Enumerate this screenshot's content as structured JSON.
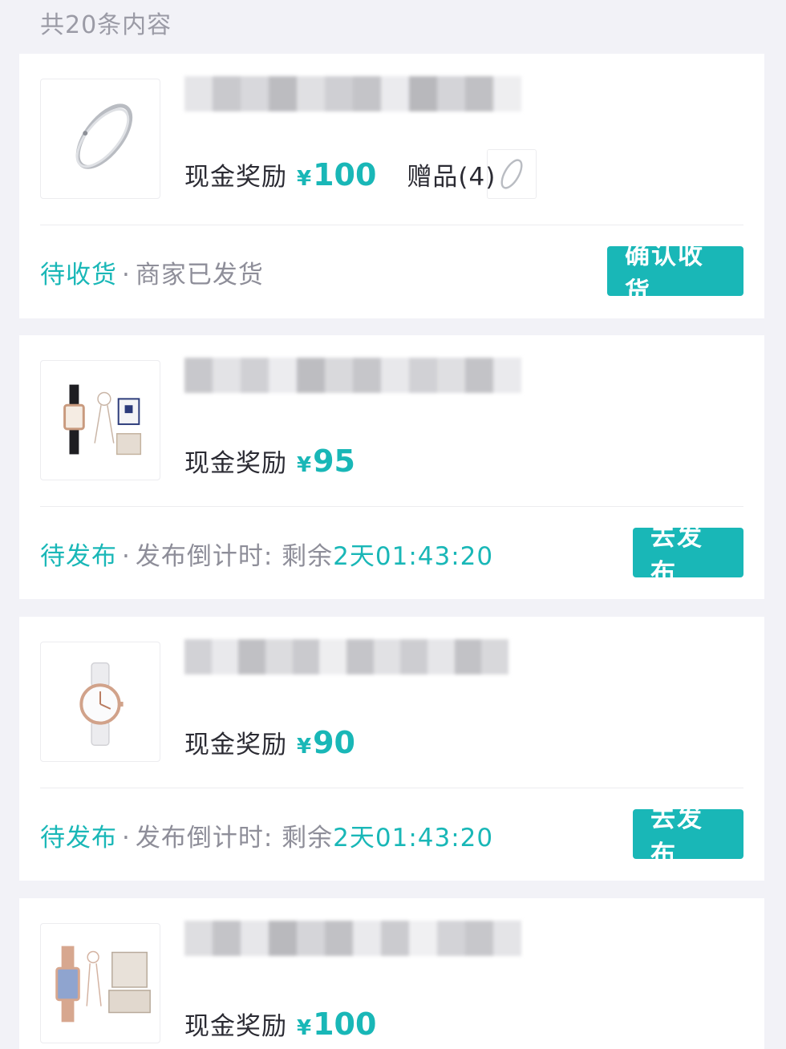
{
  "header": {
    "count_text": "共20条内容"
  },
  "orders": [
    {
      "product_icon": "bracelet-icon",
      "reward_label": "现金奖励",
      "currency": "¥",
      "amount": "100",
      "gift_label": "赠品(4)",
      "status_main": "待收货",
      "separator": "·",
      "status_sub": "商家已发货",
      "status_time": "",
      "action_label": "确认收货"
    },
    {
      "product_icon": "watch-gift-set-icon",
      "reward_label": "现金奖励",
      "currency": "¥",
      "amount": "95",
      "status_main": "待发布",
      "separator": "·",
      "status_sub": "发布倒计时: 剩余",
      "status_time": "2天01:43:20",
      "action_label": "去发布"
    },
    {
      "product_icon": "white-watch-icon",
      "reward_label": "现金奖励",
      "currency": "¥",
      "amount": "90",
      "status_main": "待发布",
      "separator": "·",
      "status_sub": "发布倒计时: 剩余",
      "status_time": "2天01:43:20",
      "action_label": "去发布"
    },
    {
      "product_icon": "rose-gold-watch-set-icon",
      "reward_label": "现金奖励",
      "currency": "¥",
      "amount": "100"
    }
  ],
  "colors": {
    "accent": "#19b7b7",
    "text": "#2b2b33",
    "muted": "#8e8e99",
    "background": "#f2f2f7"
  }
}
